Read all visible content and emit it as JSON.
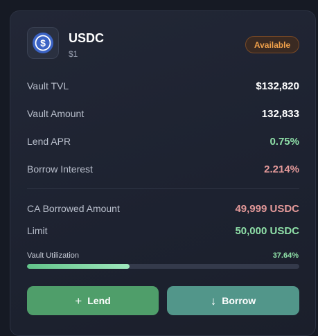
{
  "token": {
    "symbol": "USDC",
    "price": "$1",
    "status_badge": "Available",
    "icon": "usdc-logo-icon"
  },
  "stats": {
    "vault_tvl": {
      "label": "Vault TVL",
      "value": "$132,820"
    },
    "vault_amount": {
      "label": "Vault Amount",
      "value": "132,833"
    },
    "lend_apr": {
      "label": "Lend APR",
      "value": "0.75%"
    },
    "borrow_interest": {
      "label": "Borrow Interest",
      "value": "2.214%"
    }
  },
  "account": {
    "borrowed": {
      "label": "CA Borrowed Amount",
      "value": "49,999 USDC"
    },
    "limit": {
      "label": "Limit",
      "value": "50,000 USDC"
    }
  },
  "utilization": {
    "label": "Vault Utilization",
    "value_text": "37.64%",
    "fraction": 0.3764
  },
  "actions": {
    "lend_label": "Lend",
    "borrow_label": "Borrow"
  },
  "colors": {
    "accent_green": "#8fe0a8",
    "accent_red": "#e59a9a",
    "badge_orange": "#f0a04a",
    "usdc_blue": "#2775ca"
  }
}
